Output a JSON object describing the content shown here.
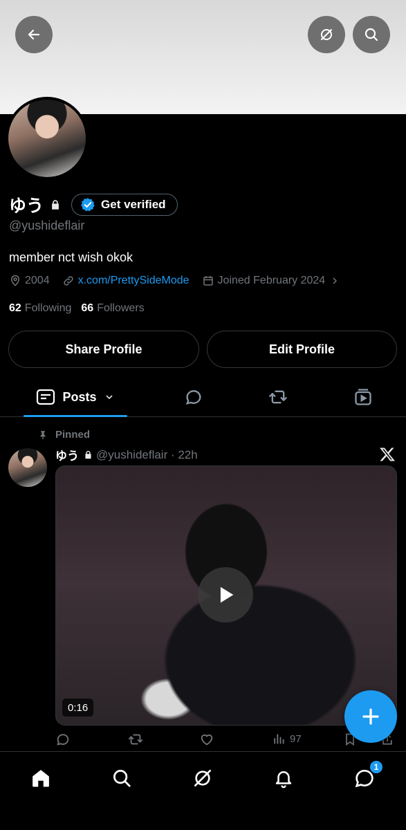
{
  "profile": {
    "name": "ゆう",
    "handle": "@yushideflair",
    "bio": "member nct wish okok",
    "verify_label": "Get verified",
    "location": "2004",
    "website": "x.com/PrettySideMode",
    "joined": "Joined February 2024",
    "following_count": "62",
    "following_label": "Following",
    "followers_count": "66",
    "followers_label": "Followers"
  },
  "buttons": {
    "share": "Share Profile",
    "edit": "Edit Profile"
  },
  "tabs": {
    "posts_label": "Posts"
  },
  "post": {
    "pinned_label": "Pinned",
    "author_name": "ゆう",
    "author_handle": "@yushideflair · 22h",
    "video_duration": "0:16",
    "views": "97"
  },
  "nav": {
    "messages_badge": "1"
  },
  "colors": {
    "accent": "#1d9bf0",
    "background": "#000000",
    "muted_text": "#71767b"
  }
}
